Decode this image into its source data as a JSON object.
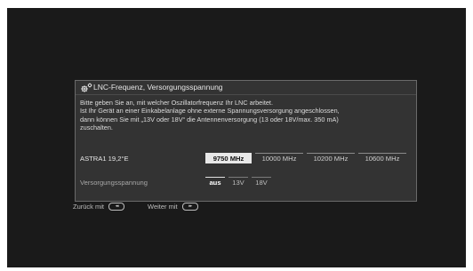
{
  "dialog": {
    "title": "LNC-Frequenz, Versorgungsspannung",
    "icon": "gear-icon",
    "description": [
      "Bitte geben Sie an, mit welcher Oszillatorfrequenz Ihr LNC arbeitet.",
      "Ist Ihr Gerät an einer Einkabelanlage ohne externe Spannungsversorgung angeschlossen,",
      "dann können Sie mit „13V oder 18V“ die Antennenversorgung (13 oder 18V/max. 350 mA)",
      "zuschalten."
    ],
    "frequency_row": {
      "label": "ASTRA1 19,2°E",
      "options": [
        "9750 MHz",
        "10000 MHz",
        "10200 MHz",
        "10600 MHz"
      ],
      "selected": "9750 MHz"
    },
    "voltage_row": {
      "label": "Versorgungsspannung",
      "options": [
        "aus",
        "13V",
        "18V"
      ],
      "selected": "aus"
    }
  },
  "footer": {
    "back_label": "Zurück mit",
    "back_key": "rewind-key-icon",
    "forward_label": "Weiter mit",
    "forward_key": "fast-forward-key-icon"
  },
  "colors": {
    "screen_bg": "#1a1a1a",
    "dialog_bg": "#333333",
    "selected_bg": "#e8e8e8"
  }
}
